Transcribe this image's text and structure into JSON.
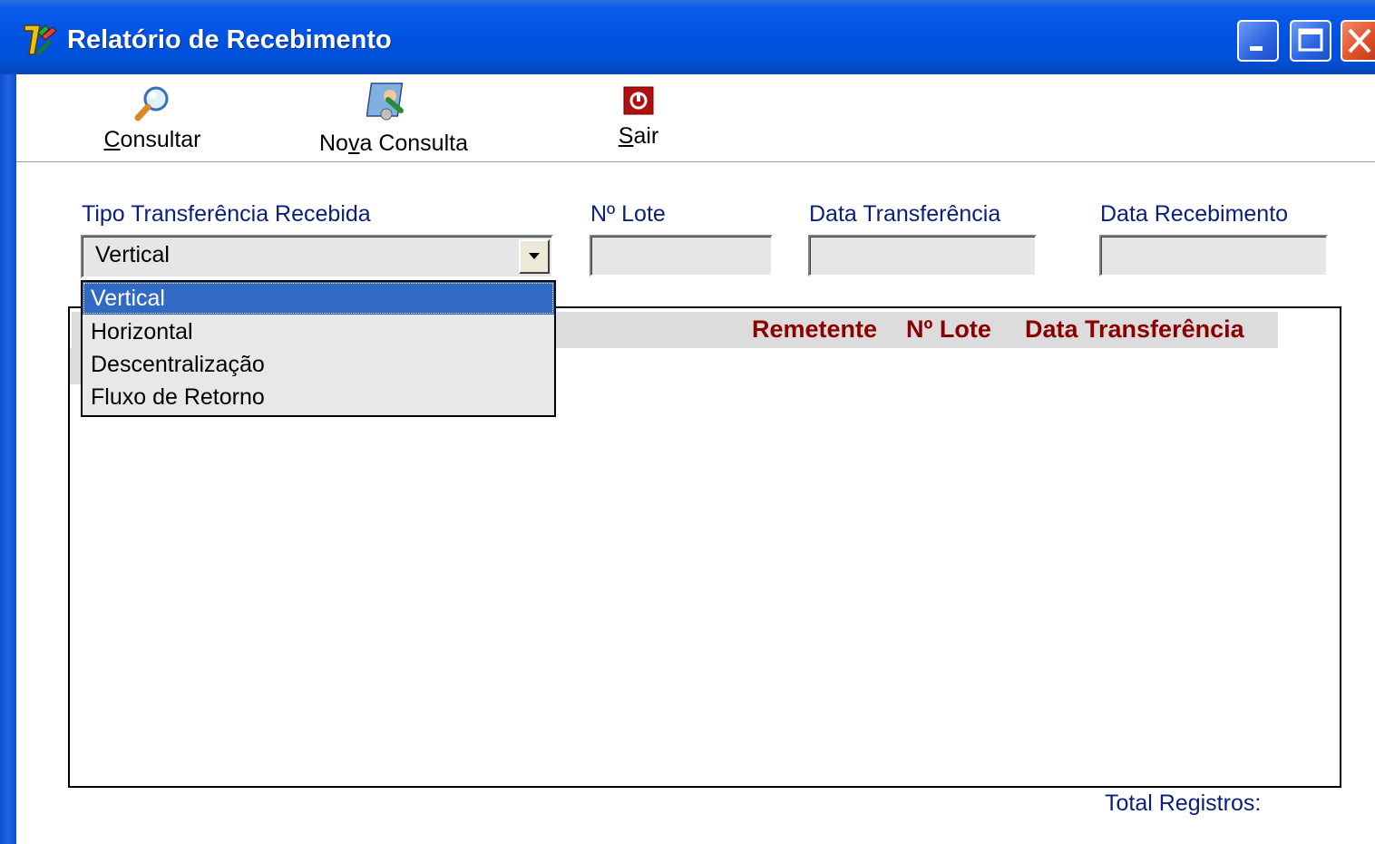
{
  "window": {
    "title": "Relatório de Recebimento"
  },
  "toolbar": {
    "consultar": {
      "underline": "C",
      "rest": "onsultar"
    },
    "nova_consulta": {
      "pre": "No",
      "underline": "v",
      "post": "a Consulta"
    },
    "sair": {
      "underline": "S",
      "rest": "air"
    }
  },
  "form": {
    "tipo_label": "Tipo Transferência Recebida",
    "tipo_value": "Vertical",
    "lote_label": "Nº Lote",
    "data_transf_label": "Data Transferência",
    "data_receb_label": "Data Recebimento",
    "lote_value": "",
    "data_transf_value": "",
    "data_receb_value": ""
  },
  "dropdown": {
    "options": [
      "Vertical",
      "Horizontal",
      "Descentralização",
      "Fluxo de Retorno"
    ],
    "selected_index": 0
  },
  "grid": {
    "columns": [
      "Remetente",
      "Nº Lote",
      "Data Transferência"
    ]
  },
  "footer": {
    "total_label": "Total Registros:"
  },
  "colors": {
    "title_bar": "#0054e3",
    "grid_header_text": "#8b0000",
    "selection": "#316ac5",
    "label_text": "#0a1f7a"
  },
  "icons": [
    "app-icon",
    "minimize-icon",
    "maximize-icon",
    "close-icon",
    "magnifier-icon",
    "new-search-icon",
    "power-icon",
    "dropdown-arrow-icon"
  ]
}
